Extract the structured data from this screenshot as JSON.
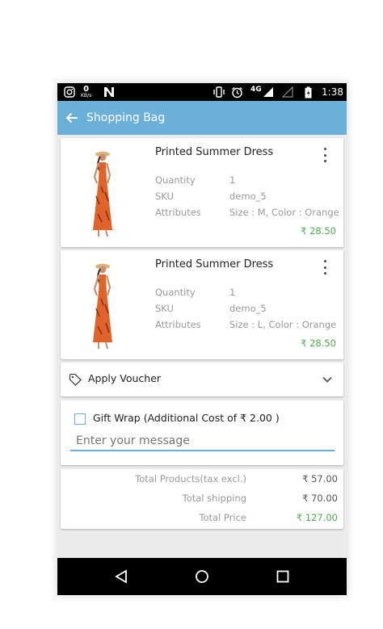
{
  "status_bar": {
    "net_speed_value": "0",
    "net_speed_unit": "KB/s",
    "network": "4G",
    "time": "1:38"
  },
  "app_bar": {
    "title": "Shopping Bag",
    "accent_color": "#6bb0d9"
  },
  "cart_items": [
    {
      "name": "Printed Summer Dress",
      "quantity_label": "Quantity",
      "quantity": "1",
      "sku_label": "SKU",
      "sku": "demo_5",
      "attributes_label": "Attributes",
      "attributes": "Size : M, Color : Orange",
      "price": "₹ 28.50"
    },
    {
      "name": "Printed Summer Dress",
      "quantity_label": "Quantity",
      "quantity": "1",
      "sku_label": "SKU",
      "sku": "demo_5",
      "attributes_label": "Attributes",
      "attributes": "Size : L, Color : Orange",
      "price": "₹ 28.50"
    }
  ],
  "voucher": {
    "label": "Apply Voucher"
  },
  "gift_wrap": {
    "label": "Gift Wrap  (Additional Cost of ₹ 2.00 )",
    "checked": false,
    "message_placeholder": "Enter your message",
    "message_value": ""
  },
  "totals": [
    {
      "label": "Total Products(tax excl.)",
      "value": "₹ 57.00"
    },
    {
      "label": "Total shipping",
      "value": "₹ 70.00"
    },
    {
      "label": "Total Price",
      "value": "₹ 127.00"
    }
  ],
  "colors": {
    "price_green": "#4caf50",
    "label_gray": "#9a9a9a"
  }
}
